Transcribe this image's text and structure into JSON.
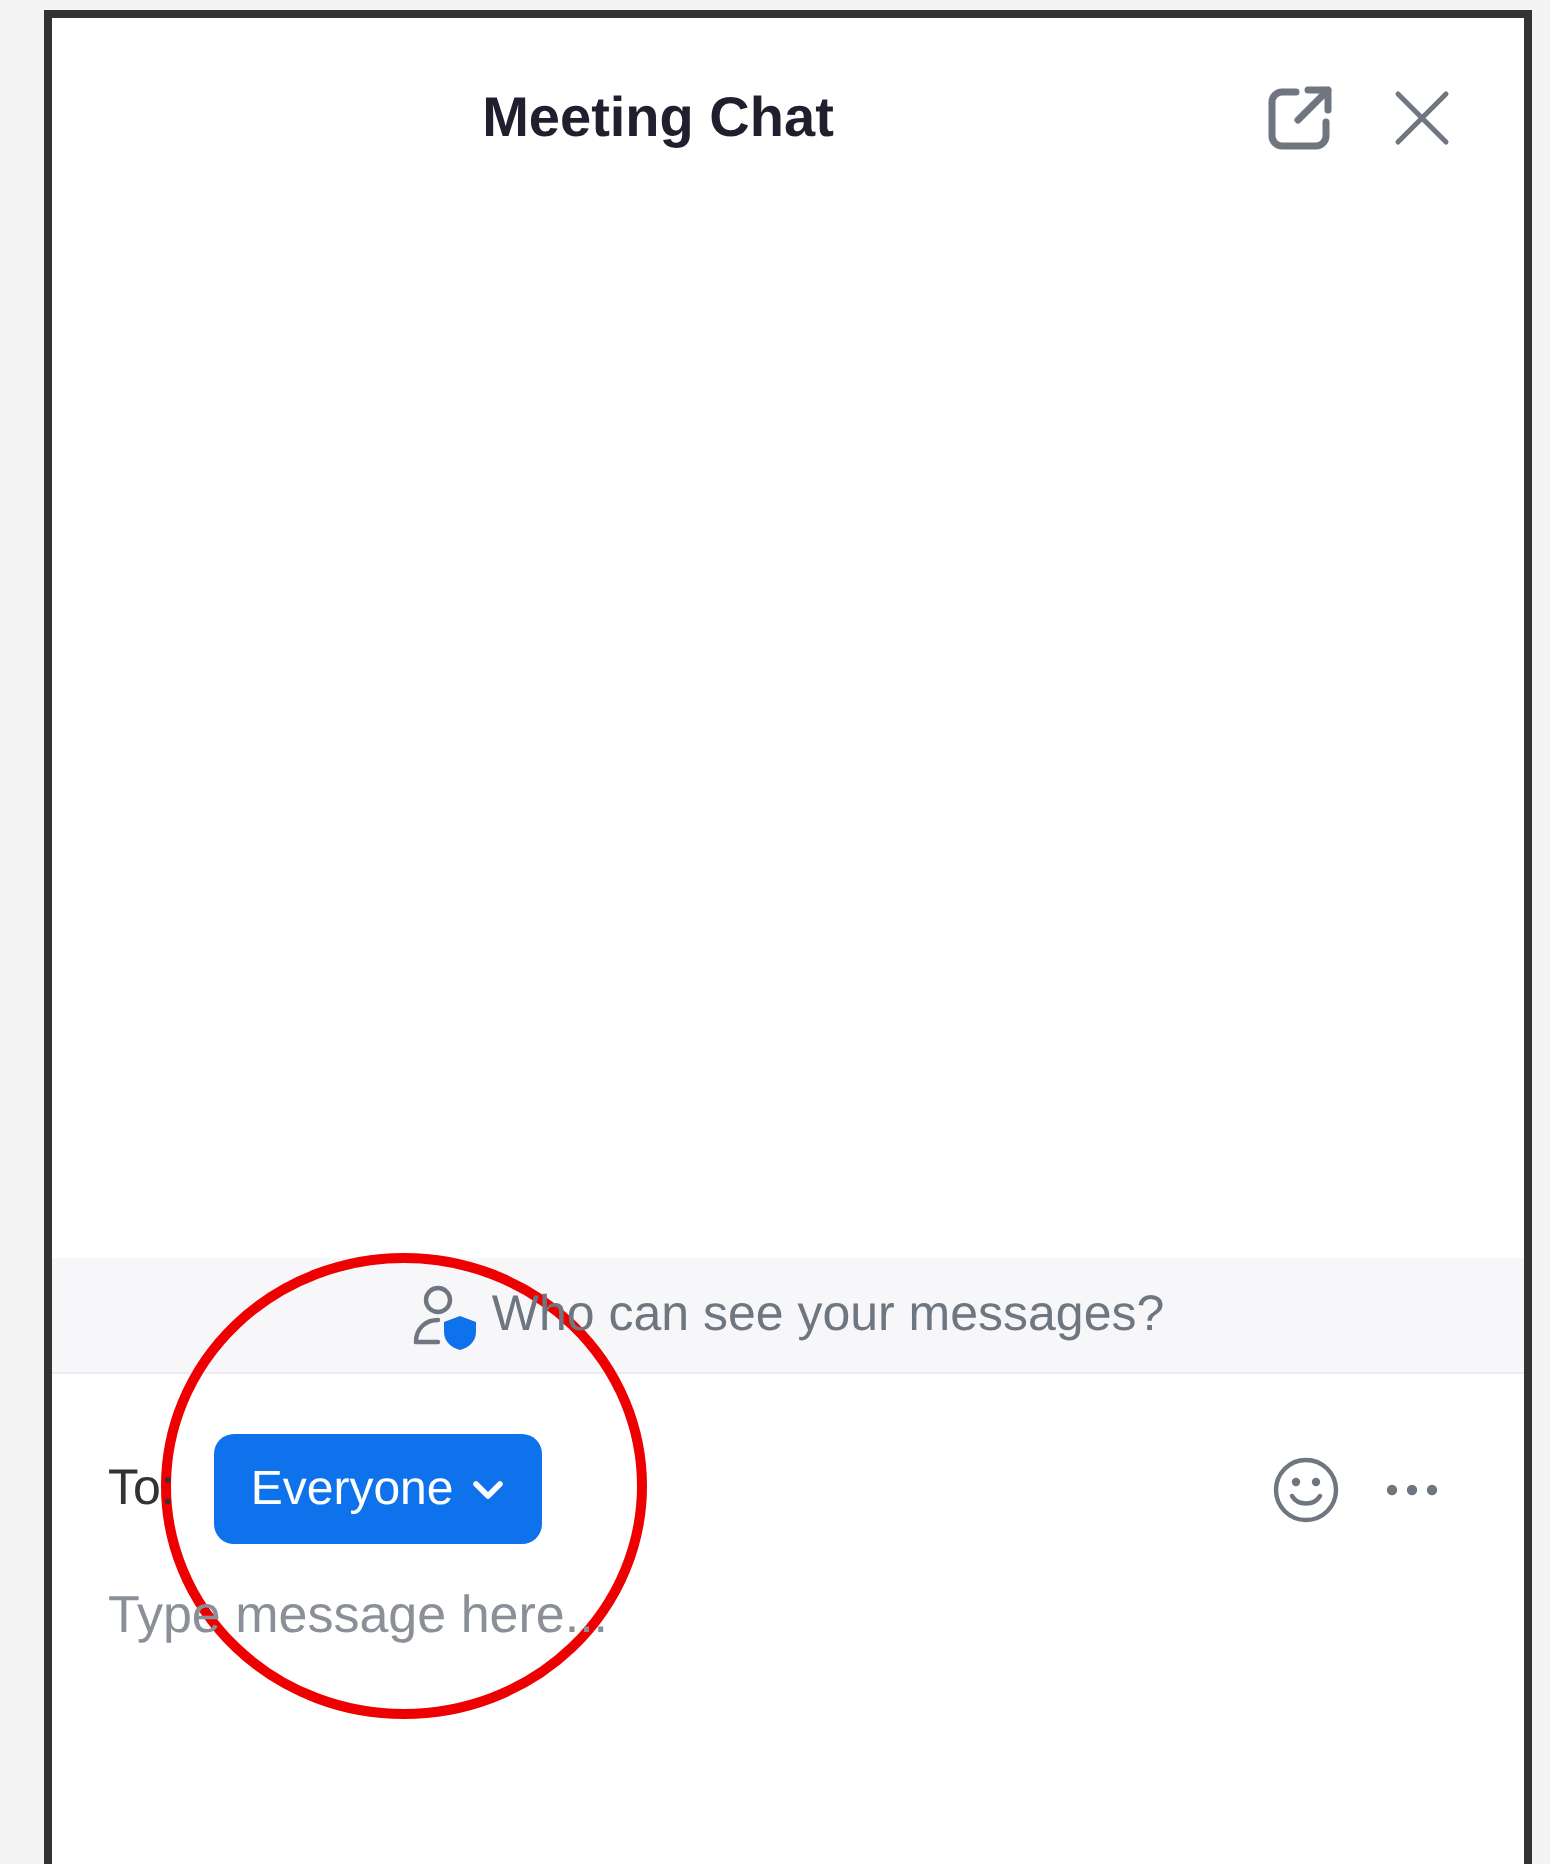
{
  "header": {
    "title": "Meeting Chat"
  },
  "notice": {
    "text": "Who can see your messages?"
  },
  "composer": {
    "to_label": "To:",
    "recipient": "Everyone",
    "placeholder": "Type message here..."
  }
}
